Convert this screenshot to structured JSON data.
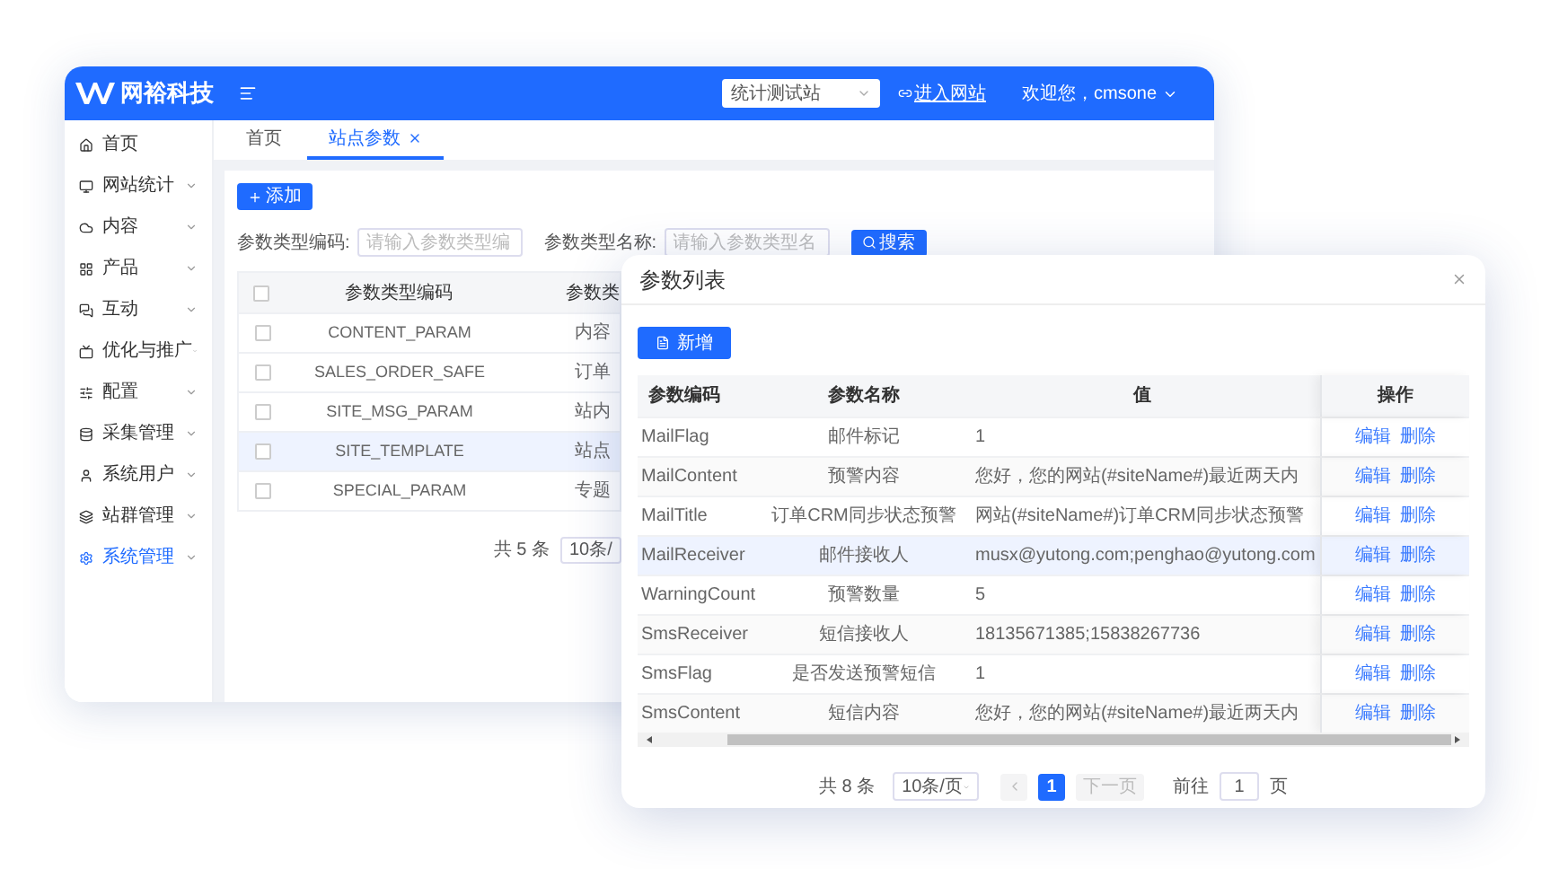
{
  "app": {
    "logo_text": "网裕科技",
    "site_select": {
      "value": "统计测试站"
    },
    "site_link": "进入网站",
    "user": "欢迎您，cmsone"
  },
  "sidebar": {
    "items": [
      {
        "label": "首页",
        "kind": "link",
        "selected": false
      },
      {
        "label": "网站统计",
        "kind": "group",
        "selected": false
      },
      {
        "label": "内容",
        "kind": "group",
        "selected": false
      },
      {
        "label": "产品",
        "kind": "group",
        "selected": false
      },
      {
        "label": "互动",
        "kind": "group",
        "selected": false
      },
      {
        "label": "优化与推广",
        "kind": "group",
        "selected": false
      },
      {
        "label": "配置",
        "kind": "group",
        "selected": false
      },
      {
        "label": "采集管理",
        "kind": "group",
        "selected": false
      },
      {
        "label": "系统用户",
        "kind": "group",
        "selected": false
      },
      {
        "label": "站群管理",
        "kind": "group",
        "selected": false
      },
      {
        "label": "系统管理",
        "kind": "group",
        "selected": true
      }
    ]
  },
  "tabs": [
    {
      "label": "首页",
      "selected": false,
      "closable": false
    },
    {
      "label": "站点参数",
      "selected": true,
      "closable": true
    }
  ],
  "add_button": "添加",
  "filters": [
    {
      "label": "参数类型编码:",
      "placeholder": "请输入参数类型编"
    },
    {
      "label": "参数类型名称:",
      "placeholder": "请输入参数类型名"
    }
  ],
  "search_button": "搜索",
  "table": {
    "columns": [
      "参数类型编码",
      "参数类"
    ],
    "header_checked": false,
    "rows": [
      {
        "checked": false,
        "highlighted": false,
        "cells": [
          "CONTENT_PARAM",
          "内容"
        ]
      },
      {
        "checked": false,
        "highlighted": false,
        "cells": [
          "SALES_ORDER_SAFE",
          "订单"
        ]
      },
      {
        "checked": false,
        "highlighted": false,
        "cells": [
          "SITE_MSG_PARAM",
          "站内"
        ]
      },
      {
        "checked": false,
        "highlighted": true,
        "cells": [
          "SITE_TEMPLATE",
          "站点"
        ]
      },
      {
        "checked": false,
        "highlighted": false,
        "cells": [
          "SPECIAL_PARAM",
          "专题"
        ]
      }
    ]
  },
  "pagination": {
    "total": "共 5 条",
    "page_size": "10条/"
  },
  "dialog": {
    "title": "参数列表",
    "add_button": "新增",
    "table": {
      "columns": [
        "参数编码",
        "参数名称",
        "值",
        "操作"
      ],
      "rows": [
        {
          "code": "MailFlag",
          "name": "邮件标记",
          "value": "1",
          "actions": [
            "编辑",
            "删除"
          ],
          "highlighted": false
        },
        {
          "code": "MailContent",
          "name": "预警内容",
          "value": "您好，您的网站(#siteName#)最近两天内",
          "actions": [
            "编辑",
            "删除"
          ],
          "highlighted": false
        },
        {
          "code": "MailTitle",
          "name": "订单CRM同步状态预警",
          "value": "网站(#siteName#)订单CRM同步状态预警",
          "actions": [
            "编辑",
            "删除"
          ],
          "highlighted": false
        },
        {
          "code": "MailReceiver",
          "name": "邮件接收人",
          "value": "musx@yutong.com;penghao@yutong.com",
          "actions": [
            "编辑",
            "删除"
          ],
          "highlighted": true
        },
        {
          "code": "WarningCount",
          "name": "预警数量",
          "value": "5",
          "actions": [
            "编辑",
            "删除"
          ],
          "highlighted": false
        },
        {
          "code": "SmsReceiver",
          "name": "短信接收人",
          "value": "18135671385;15838267736",
          "actions": [
            "编辑",
            "删除"
          ],
          "highlighted": false
        },
        {
          "code": "SmsFlag",
          "name": "是否发送预警短信",
          "value": "1",
          "actions": [
            "编辑",
            "删除"
          ],
          "highlighted": false
        },
        {
          "code": "SmsContent",
          "name": "短信内容",
          "value": "您好，您的网站(#siteName#)最近两天内",
          "actions": [
            "编辑",
            "删除"
          ],
          "highlighted": false
        }
      ]
    },
    "pagination": {
      "total": "共 8 条",
      "page_size": "10条/页",
      "prev_disabled": true,
      "pages": [
        {
          "label": "1",
          "selected": true
        }
      ],
      "next": {
        "label": "下一页",
        "disabled": true
      },
      "jump_label": "前往",
      "jump_value": "1",
      "jump_suffix": "页"
    }
  }
}
